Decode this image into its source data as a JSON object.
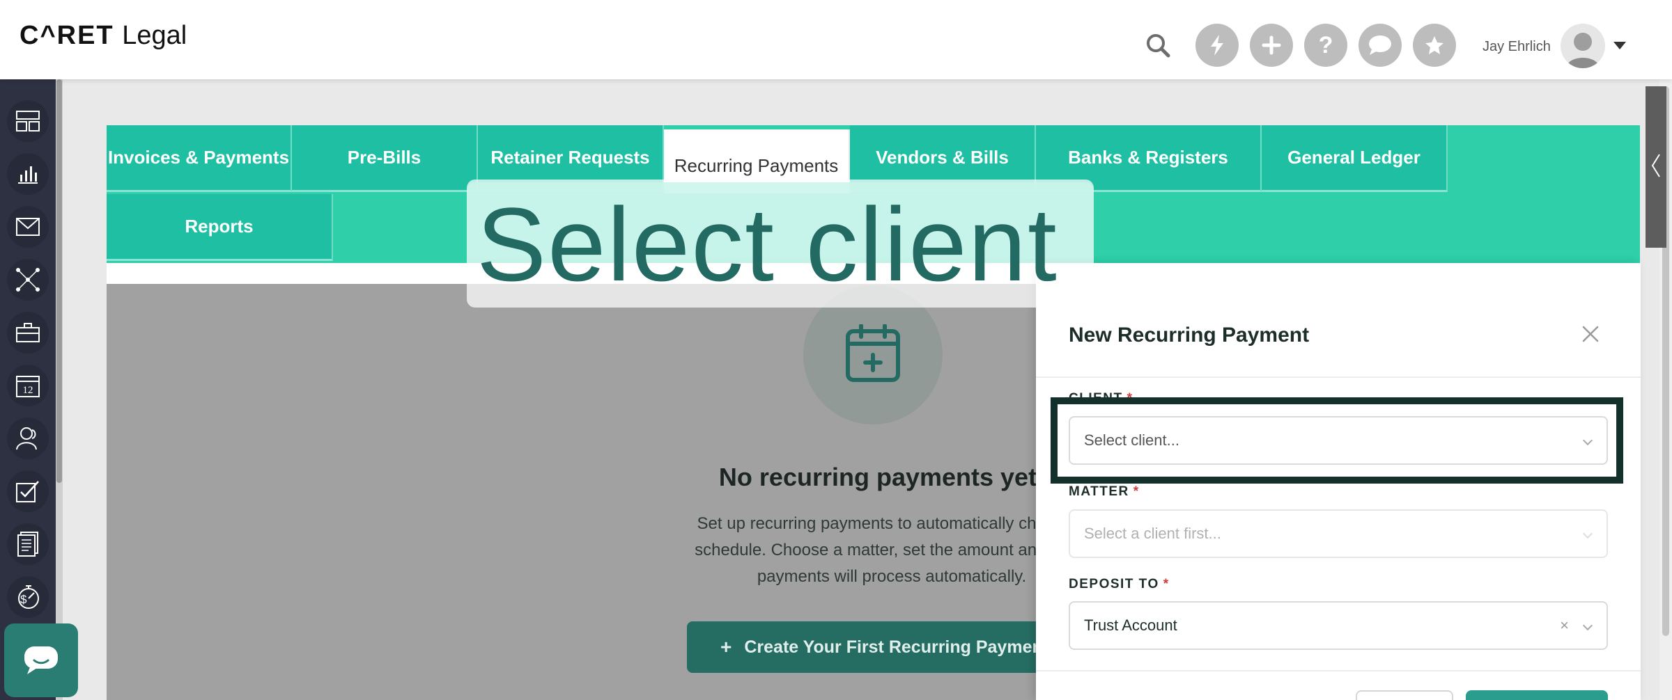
{
  "app": {
    "logo_text": "CARET Legal",
    "logo_brand": "C^RET",
    "logo_suffix": "Legal"
  },
  "header": {
    "user_name": "Jay Ehrlich",
    "icons": [
      "search-icon",
      "lightning-icon",
      "plus-icon",
      "help-icon",
      "chat-bubble-icon",
      "star-icon"
    ]
  },
  "sidebar": {
    "items": [
      {
        "icon": "dashboard-icon"
      },
      {
        "icon": "reports-chart-icon"
      },
      {
        "icon": "mail-icon"
      },
      {
        "icon": "network-icon"
      },
      {
        "icon": "briefcase-icon"
      },
      {
        "icon": "calendar-icon",
        "label": "12"
      },
      {
        "icon": "contacts-icon"
      },
      {
        "icon": "tasks-check-icon"
      },
      {
        "icon": "documents-icon"
      },
      {
        "icon": "billing-timer-icon"
      }
    ]
  },
  "tabs": {
    "row1": [
      {
        "label": "Invoices & Payments"
      },
      {
        "label": "Pre-Bills"
      },
      {
        "label": "Retainer Requests"
      },
      {
        "label": "Recurring Payments",
        "active": true
      },
      {
        "label": "Vendors & Bills"
      },
      {
        "label": "Banks & Registers"
      },
      {
        "label": "General Ledger"
      }
    ],
    "row2": [
      {
        "label": "Reports"
      }
    ]
  },
  "empty_state": {
    "title": "No recurring payments yet",
    "description": "Set up recurring payments to automatically charge cl schedule. Choose a matter, set the amount and frequ payments will process automatically.",
    "line1": "Set up recurring payments to automatically charge cl",
    "line2": "schedule. Choose a matter, set the amount and frequ",
    "line3": "payments will process automatically.",
    "create_button": "Create Your First Recurring Payment"
  },
  "drawer": {
    "title": "New Recurring Payment",
    "fields": {
      "client": {
        "label": "CLIENT",
        "placeholder": "Select client..."
      },
      "matter": {
        "label": "MATTER",
        "placeholder": "Select a client first..."
      },
      "deposit_to": {
        "label": "DEPOSIT TO",
        "value": "Trust Account"
      }
    }
  },
  "tooltip": {
    "text": "Select client"
  },
  "colors": {
    "accent": "#2ecfa9",
    "tab": "#1fbfa3",
    "button": "#256d63",
    "sidebar": "#2d3142",
    "required": "#d23b3b"
  }
}
